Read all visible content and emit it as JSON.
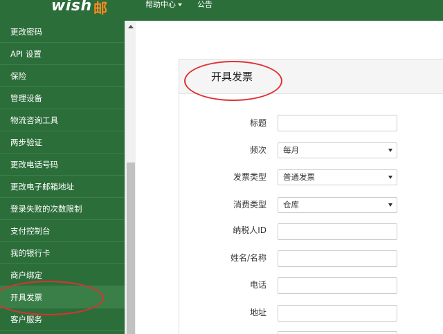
{
  "header": {
    "logo": "wish",
    "logo_cn": "邮",
    "nav_help": "帮助中心",
    "nav_notice": "公告"
  },
  "sidebar": {
    "items": [
      {
        "label": "更改密码"
      },
      {
        "label": "API 设置"
      },
      {
        "label": "保险"
      },
      {
        "label": "管理设备"
      },
      {
        "label": "物流咨询工具"
      },
      {
        "label": "两步验证"
      },
      {
        "label": "更改电话号码"
      },
      {
        "label": "更改电子邮箱地址"
      },
      {
        "label": "登录失败的次数限制"
      },
      {
        "label": "支付控制台"
      },
      {
        "label": "我的银行卡"
      },
      {
        "label": "商户绑定"
      },
      {
        "label": "开具发票"
      },
      {
        "label": "客户服务"
      }
    ]
  },
  "panel": {
    "title": "开具发票"
  },
  "form": {
    "title_label": "标题",
    "title_value": "",
    "frequency_label": "频次",
    "frequency_value": "每月",
    "invoice_type_label": "发票类型",
    "invoice_type_value": "普通发票",
    "consumption_type_label": "消费类型",
    "consumption_type_value": "仓库",
    "taxpayer_id_label": "纳税人ID",
    "taxpayer_id_value": "",
    "name_label": "姓名/名称",
    "name_value": "",
    "phone_label": "电话",
    "phone_value": "",
    "address_label": "地址",
    "address_value": ""
  },
  "colors": {
    "brand_green": "#2c6e3a",
    "logo_orange": "#ff8a1f",
    "annotation_red": "#e03030"
  }
}
